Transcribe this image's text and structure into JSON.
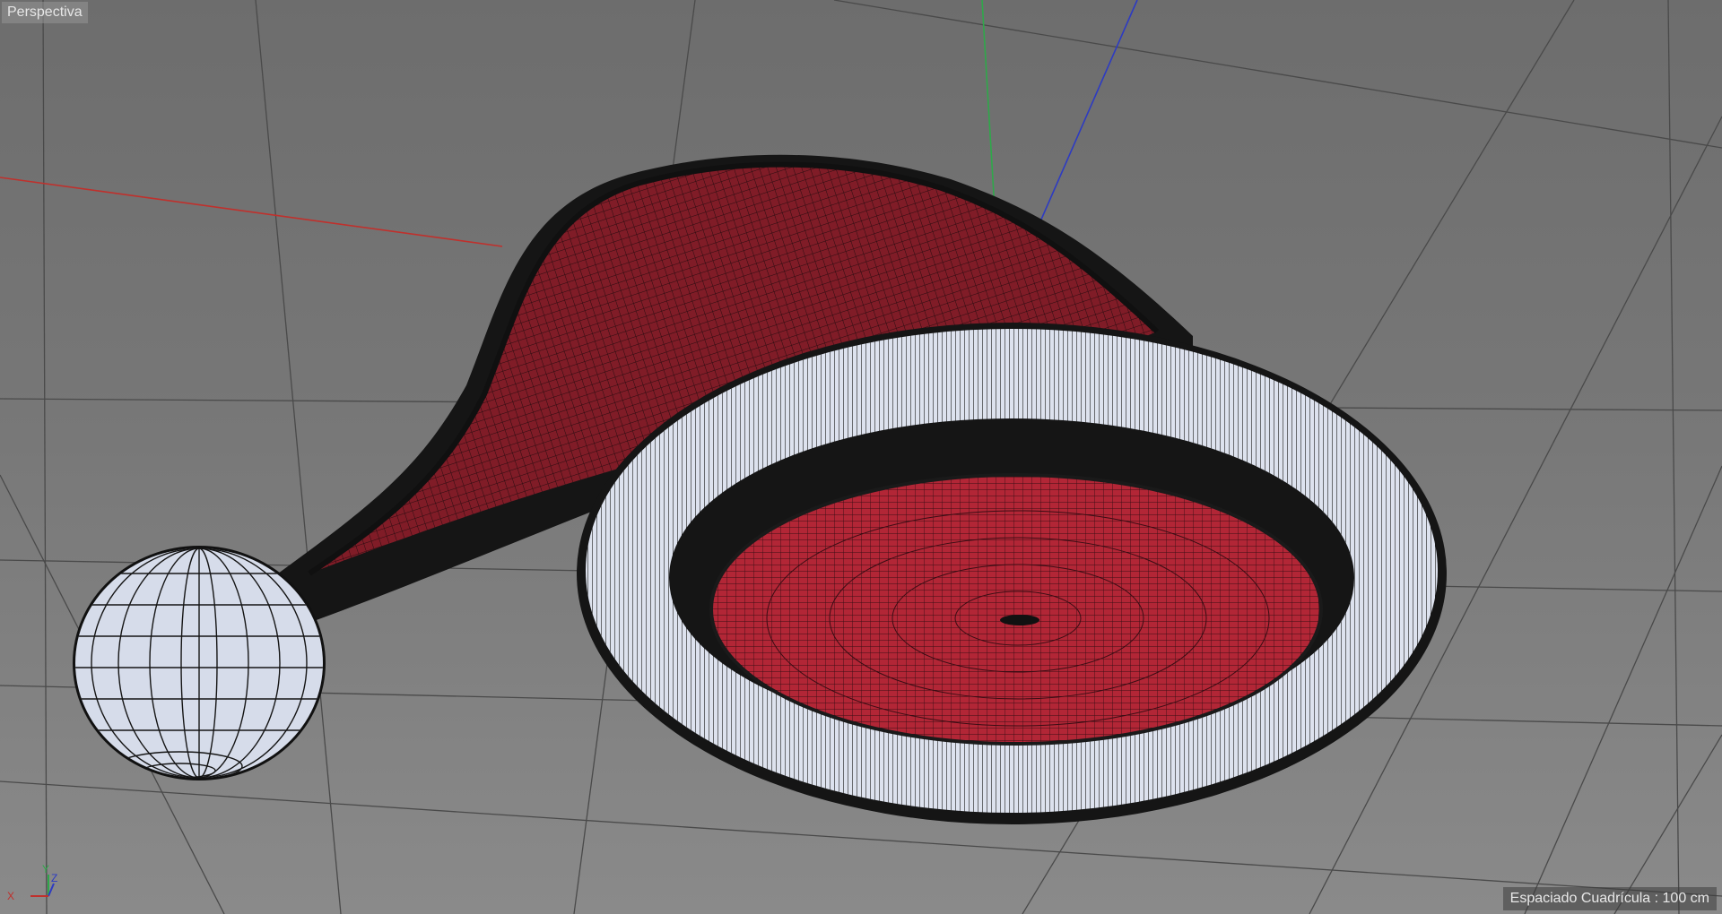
{
  "viewport": {
    "view_name": "Perspectiva",
    "grid_spacing_text": "Espaciado Cuadrícula : 100 cm"
  },
  "axis_gizmo": {
    "x_label": "X",
    "y_label": "Y",
    "z_label": "Z"
  },
  "colors": {
    "background_top": "#6d6d6d",
    "background_bottom": "#8a8a8a",
    "grid_line": "#4a4a4a",
    "x_axis": "#c0302c",
    "y_axis": "#2fa84a",
    "z_axis": "#2d3bc2",
    "hat_red": "#8e1f2c",
    "hat_inner_red": "#b82838",
    "fur_white": "#dfe4f0",
    "wire": "#151515"
  },
  "objects": [
    {
      "name": "Gorro",
      "icon": "hat-mesh"
    },
    {
      "name": "Borde",
      "icon": "torus-mesh"
    },
    {
      "name": "Pompón",
      "icon": "sphere-mesh"
    }
  ]
}
